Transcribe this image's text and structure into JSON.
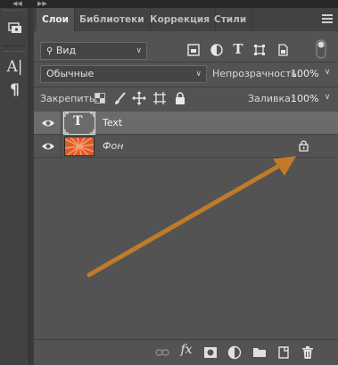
{
  "tabs": [
    {
      "label": "Слои"
    },
    {
      "label": "Библиотеки"
    },
    {
      "label": "Коррекция"
    },
    {
      "label": "Стили"
    }
  ],
  "filter": {
    "value": "Вид"
  },
  "blend_mode": {
    "value": "Обычные"
  },
  "opacity": {
    "label": "Непрозрачность:",
    "value": "100%"
  },
  "lock": {
    "label": "Закрепить:"
  },
  "fill": {
    "label": "Заливка:",
    "value": "100%"
  },
  "layers": [
    {
      "name": "Text",
      "type": "text",
      "thumb_letter": "T",
      "selected": true
    },
    {
      "name": "Фон",
      "type": "image",
      "locked": true,
      "selected": false
    }
  ],
  "bottom": {
    "fx_label": "fx"
  },
  "annotation": {
    "arrow_color": "#c07a2a"
  },
  "colors": {
    "panel": "#535353",
    "selected_row": "#6b6b6b",
    "thumb_orange": "#e05a2a"
  }
}
